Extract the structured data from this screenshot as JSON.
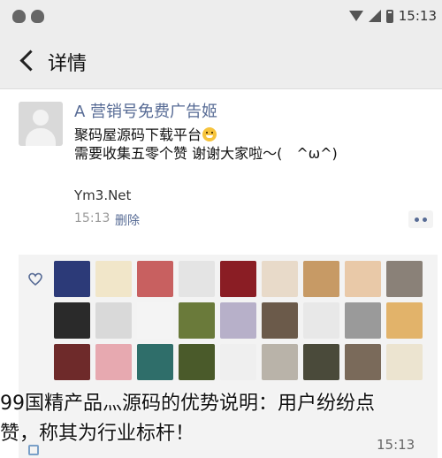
{
  "status_bar": {
    "time": "15:13"
  },
  "header": {
    "title": "详情"
  },
  "post": {
    "username": "A 营销号免费广告姬",
    "line1": "聚码屋源码下载平台",
    "line2": "需要收集五零个赞 谢谢大家啦～(　^ω^)",
    "link_text": "Ym3.Net",
    "time": "15:13",
    "delete_label": "删除"
  },
  "likes": {
    "tiles": [
      "#2c3a78",
      "#f1e6c9",
      "#c86060",
      "#e4e4e4",
      "#8a1d24",
      "#e8dac9",
      "#c79a65",
      "#e9c9a8",
      "#8a8178",
      "#2a2a2a",
      "#d9d9d9",
      "#f4f4f4",
      "#6a7a3a",
      "#b7b0c9",
      "#6b5a4a",
      "#e8e8e8",
      "#9a9a9a",
      "#e2b36a",
      "#6e2a2a",
      "#e7a9b0",
      "#2f6e6a",
      "#4a5a2a",
      "#efefef",
      "#b9b3a9",
      "#4a4a3a",
      "#7a6a5a",
      "#ece4d0"
    ]
  },
  "overlay": {
    "caption_line1": "99国精产品灬源码的优势说明：用户纷纷点",
    "caption_line2": "赞，称其为行业标杆！",
    "time": "15:13"
  }
}
